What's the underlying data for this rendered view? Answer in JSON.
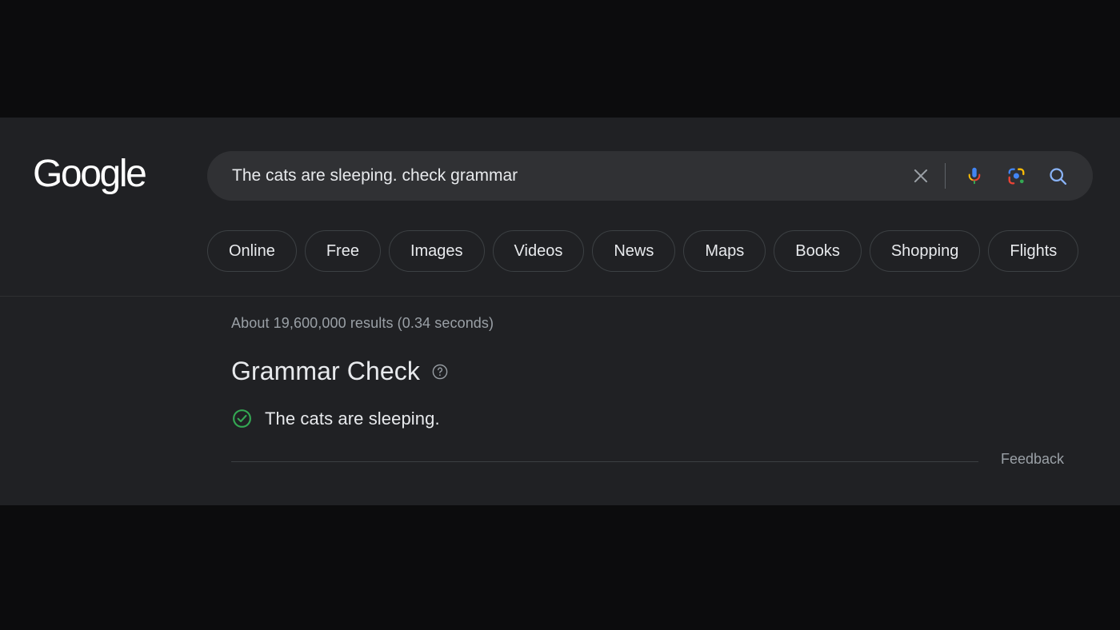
{
  "header": {
    "logo_text": "Google",
    "search": {
      "value": "The cats are sleeping. check grammar",
      "placeholder": "Search",
      "clear_label": "Clear",
      "mic_label": "Search by voice",
      "lens_label": "Search by image",
      "search_label": "Google Search"
    },
    "chips": [
      {
        "label": "Online"
      },
      {
        "label": "Free"
      },
      {
        "label": "Images"
      },
      {
        "label": "Videos"
      },
      {
        "label": "News"
      },
      {
        "label": "Maps"
      },
      {
        "label": "Books"
      },
      {
        "label": "Shopping"
      },
      {
        "label": "Flights"
      }
    ]
  },
  "results": {
    "stats": "About 19,600,000 results (0.34 seconds)",
    "grammar_card": {
      "title": "Grammar Check",
      "help_icon": "help-circle-icon",
      "status_icon": "check-circle-icon",
      "corrected_sentence": "The cats are sleeping.",
      "feedback_label": "Feedback"
    }
  },
  "colors": {
    "page_background": "#202124",
    "letterbox": "#0c0c0d",
    "search_field": "#303134",
    "primary_text": "#e8eaed",
    "secondary_text": "#9aa0a6",
    "border": "#3c4043",
    "accent_blue": "#8ab4f8",
    "success_green": "#34a853",
    "google_blue": "#4285f4",
    "google_red": "#ea4335",
    "google_yellow": "#fbbc05",
    "google_green": "#34a853"
  }
}
